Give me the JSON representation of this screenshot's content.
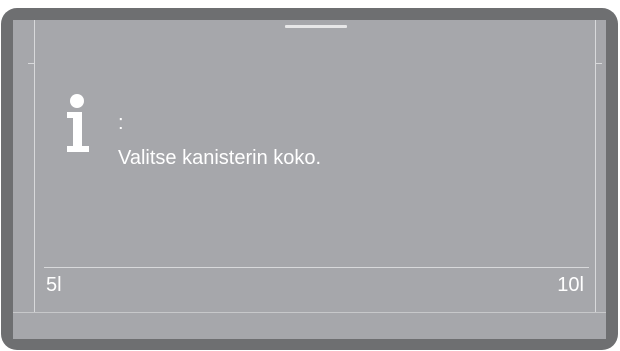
{
  "message": {
    "prefix": ":",
    "text": "Valitse kanisterin koko."
  },
  "options": [
    {
      "label": "5l"
    },
    {
      "label": "10l"
    }
  ],
  "icons": {
    "info": "info-icon"
  },
  "colors": {
    "bezel": "#6e6f71",
    "screen": "#a6a7ab",
    "text": "#ffffff"
  }
}
